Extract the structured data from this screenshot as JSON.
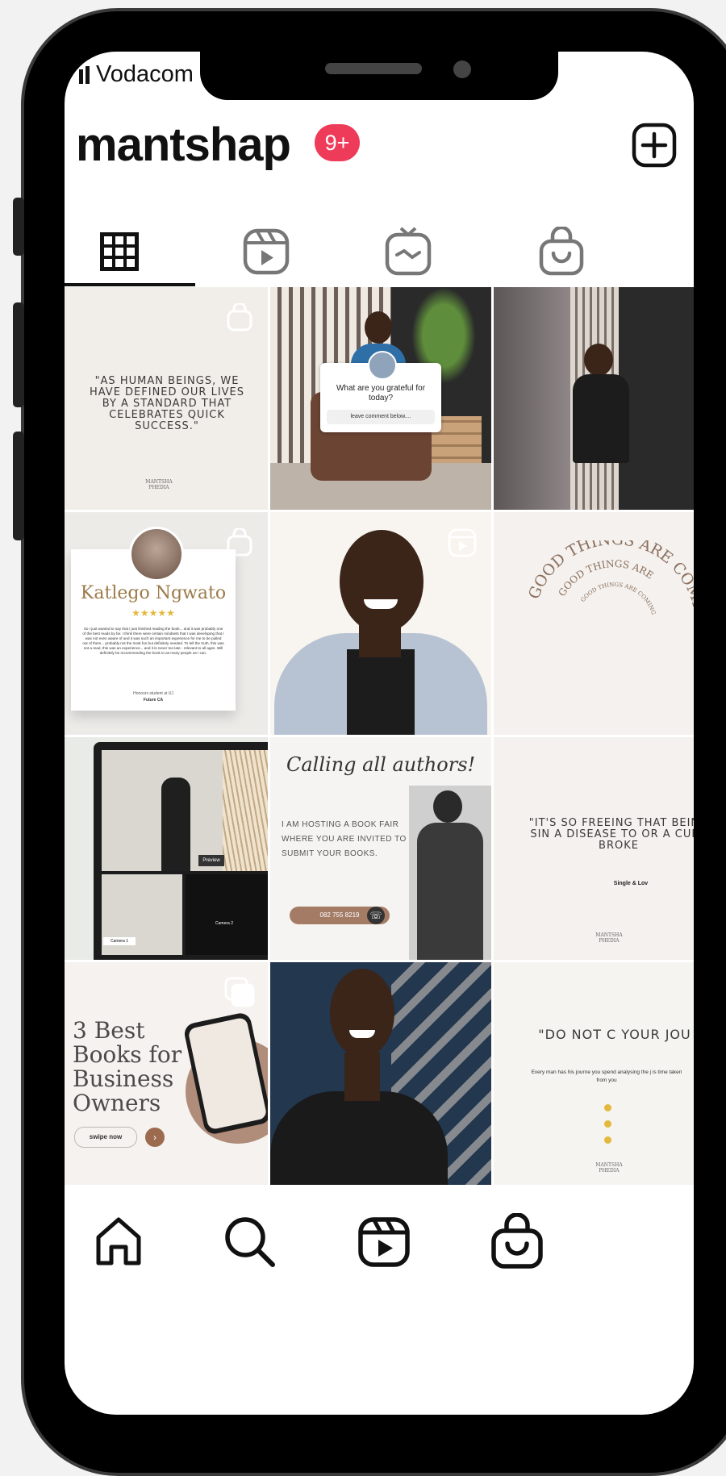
{
  "status_bar": {
    "carrier": "Vodacom"
  },
  "header": {
    "username": "mantshap",
    "notification_badge": "9+",
    "new_post_icon": "plus-square-icon"
  },
  "tabs": [
    {
      "name": "grid-icon",
      "selected": true
    },
    {
      "name": "reels-icon",
      "selected": false
    },
    {
      "name": "igtv-icon",
      "selected": false
    },
    {
      "name": "shop-icon",
      "selected": false
    }
  ],
  "posts": {
    "p1": {
      "quote": "\"AS HUMAN BEINGS, WE HAVE DEFINED OUR LIVES BY A STANDARD THAT CELEBRATES QUICK SUCCESS.\"",
      "logo": "MANTSHA PHEDIA"
    },
    "p2": {
      "question": "What are you grateful for today?",
      "input_placeholder": "leave comment below...."
    },
    "p4": {
      "name": "Katlego Ngwato",
      "stars": "★★★★★",
      "review": "So I just wanted to say that I just finished reading the book... and it was probably one of the best reads by far. I think there were certain mindsets that I was developing that I was not even aware of and it was such an important experience for me to be pulled out of them... probably not the most fun but definitely needed. To tell the truth, this was not a read, this was an experience... and it is never too late - relevant to all ages. Will definitely be recommending the book to as many people as I can.",
      "role": "Honours student at UJ",
      "role2": "Future CA"
    },
    "p6": {
      "ring1": "GOOD THINGS ARE COMING",
      "ring2": "GOOD THINGS ARE",
      "ring3": "GOOD THINGS ARE COMING"
    },
    "p7": {
      "label_preview": "Preview",
      "label_camera1": "Camera 1",
      "label_camera2": "Camera 2"
    },
    "p8": {
      "title": "Calling all authors!",
      "body": "I AM HOSTING A BOOK FAIR WHERE YOU ARE INVITED TO SUBMIT YOUR BOOKS.",
      "phone": "082 755 8219"
    },
    "p9": {
      "quote": "\"IT'S SO FREEING THAT BEING SIN A DISEASE TO OR A CURS BROKE",
      "signature": "Single & Lov",
      "logo": "MANTSHA PHEDIA"
    },
    "p10": {
      "title": "3 Best Books for Business Owners",
      "button": "swipe now"
    },
    "p12": {
      "quote": "\"DO NOT C YOUR JOU",
      "body": "Every man has his journe you spend analysing the j is time taken from you",
      "logo": "MANTSHA PHEDIA"
    }
  },
  "bottom_nav": [
    {
      "name": "home-icon"
    },
    {
      "name": "search-icon"
    },
    {
      "name": "reels-icon"
    },
    {
      "name": "shop-icon"
    }
  ],
  "colors": {
    "badge": "#ef3b5a",
    "accent_brown": "#a47c66",
    "star": "#e2b93b"
  }
}
